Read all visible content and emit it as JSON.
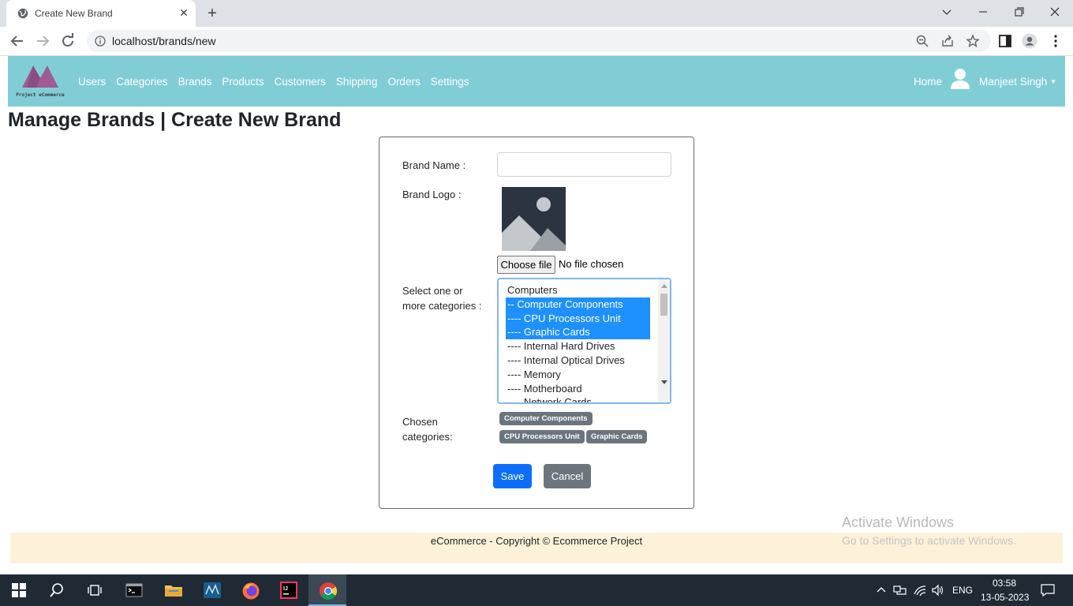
{
  "browser": {
    "tab_title": "Create New Brand",
    "url": "localhost/brands/new"
  },
  "navbar": {
    "logo_text": "Project eCommerce",
    "links": [
      "Users",
      "Categories",
      "Brands",
      "Products",
      "Customers",
      "Shipping",
      "Orders",
      "Settings"
    ],
    "home": "Home",
    "user_name": "Manjeet Singh"
  },
  "page": {
    "title": "Manage Brands | Create New Brand"
  },
  "form": {
    "brand_name_label": "Brand Name :",
    "brand_name_value": "",
    "brand_logo_label": "Brand Logo :",
    "file_button": "Choose file",
    "file_status": "No file chosen",
    "categories_label_1": "Select one or",
    "categories_label_2": "more categories :",
    "category_options": [
      {
        "label": "Computers",
        "selected": false
      },
      {
        "label": "-- Computer Components",
        "selected": true
      },
      {
        "label": "---- CPU Processors Unit",
        "selected": true
      },
      {
        "label": "---- Graphic Cards",
        "selected": true
      },
      {
        "label": "---- Internal Hard Drives",
        "selected": false
      },
      {
        "label": "---- Internal Optical Drives",
        "selected": false
      },
      {
        "label": "---- Memory",
        "selected": false
      },
      {
        "label": "---- Motherboard",
        "selected": false
      },
      {
        "label": "---- Network Cards",
        "selected": false
      }
    ],
    "chosen_label_1": "Chosen",
    "chosen_label_2": "categories:",
    "chosen_badges": [
      "Computer Components",
      "CPU Processors Unit",
      "Graphic Cards"
    ],
    "save_label": "Save",
    "cancel_label": "Cancel"
  },
  "footer": {
    "text": "eCommerce - Copyright © Ecommerce Project"
  },
  "watermark": {
    "line1": "Activate Windows",
    "line2": "Go to Settings to activate Windows."
  },
  "taskbar": {
    "language": "ENG",
    "time": "03:58",
    "date": "13-05-2023"
  },
  "colors": {
    "navbar_bg": "#81cdd6",
    "selection_blue": "#1e90ff",
    "save_button": "#0d6efd",
    "secondary": "#6c757d",
    "footer_bg": "#fdf1d9"
  }
}
